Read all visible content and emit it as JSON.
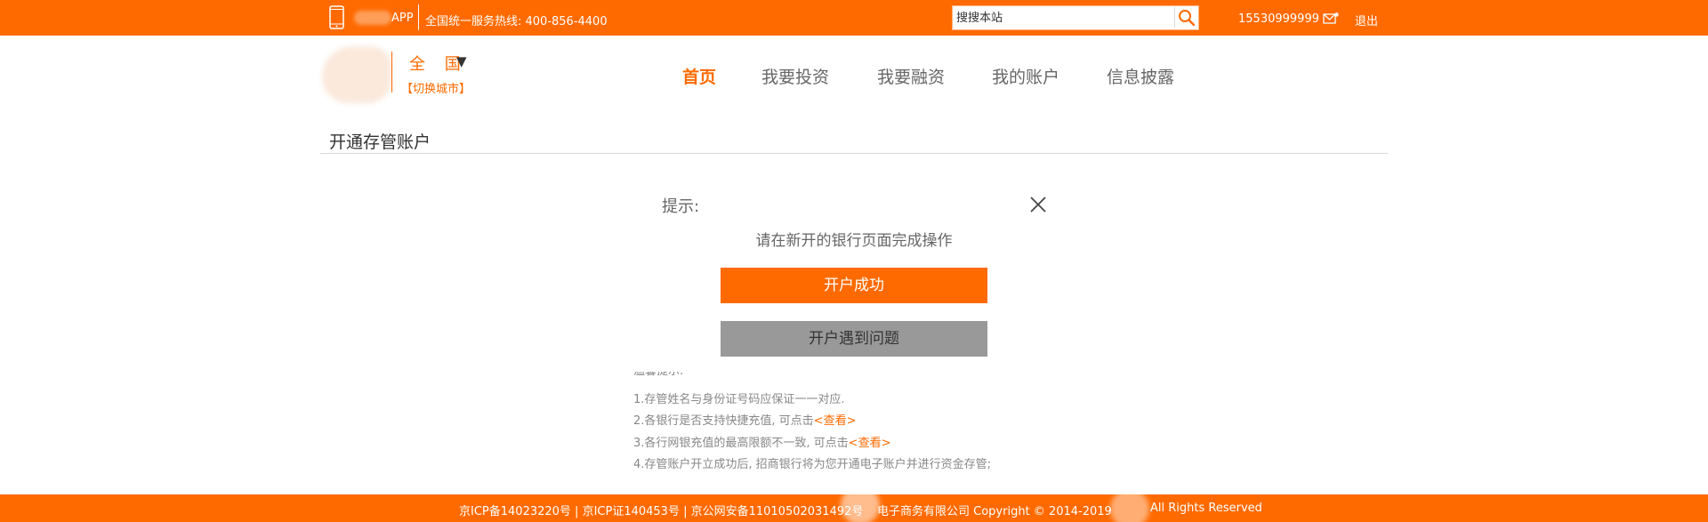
{
  "topbar": {
    "app_label": "APP",
    "hotline": "全国统一服务热线: 400-856-4400",
    "search_placeholder": "搜搜本站",
    "user_phone": "15530999999",
    "logout": "退出"
  },
  "header": {
    "city": "全 国",
    "city_caret": "▼",
    "city_switch": "【切换城市】"
  },
  "nav": {
    "items": [
      {
        "label": "首页",
        "active": true
      },
      {
        "label": "我要投资"
      },
      {
        "label": "我要融资"
      },
      {
        "label": "我的账户"
      },
      {
        "label": "信息披露"
      }
    ]
  },
  "page": {
    "title": "开通存管账户"
  },
  "dialog": {
    "title": "提示:",
    "message": "请在新开的银行页面完成操作",
    "success_button": "开户成功",
    "problem_button": "开户遇到问题"
  },
  "tips": {
    "heading": "温馨提示:",
    "line1": "1.存管姓名与身份证号码应保证一一对应.",
    "line2_text": "2.各银行是否支持快捷充值, 可点击",
    "line2_link": "<查看>",
    "line3_text": "3.各行网银充值的最高限额不一致, 可点击",
    "line3_link": "<查看>",
    "line4": "4.存管账户开立成功后, 招商银行将为您开通电子账户并进行资金存管;"
  },
  "footer": {
    "icp": "京ICP备14023220号 | 京ICP证140453号 | 京公网安备11010502031492号",
    "company": "电子商务有限公司 Copyright © 2014-2019",
    "rights": "All Rights Reserved"
  },
  "colors": {
    "brand_orange": "#ff6a00",
    "problem_gray": "#999999"
  },
  "icons": [
    "phone-icon",
    "search-icon",
    "mail-icon",
    "close-icon"
  ]
}
